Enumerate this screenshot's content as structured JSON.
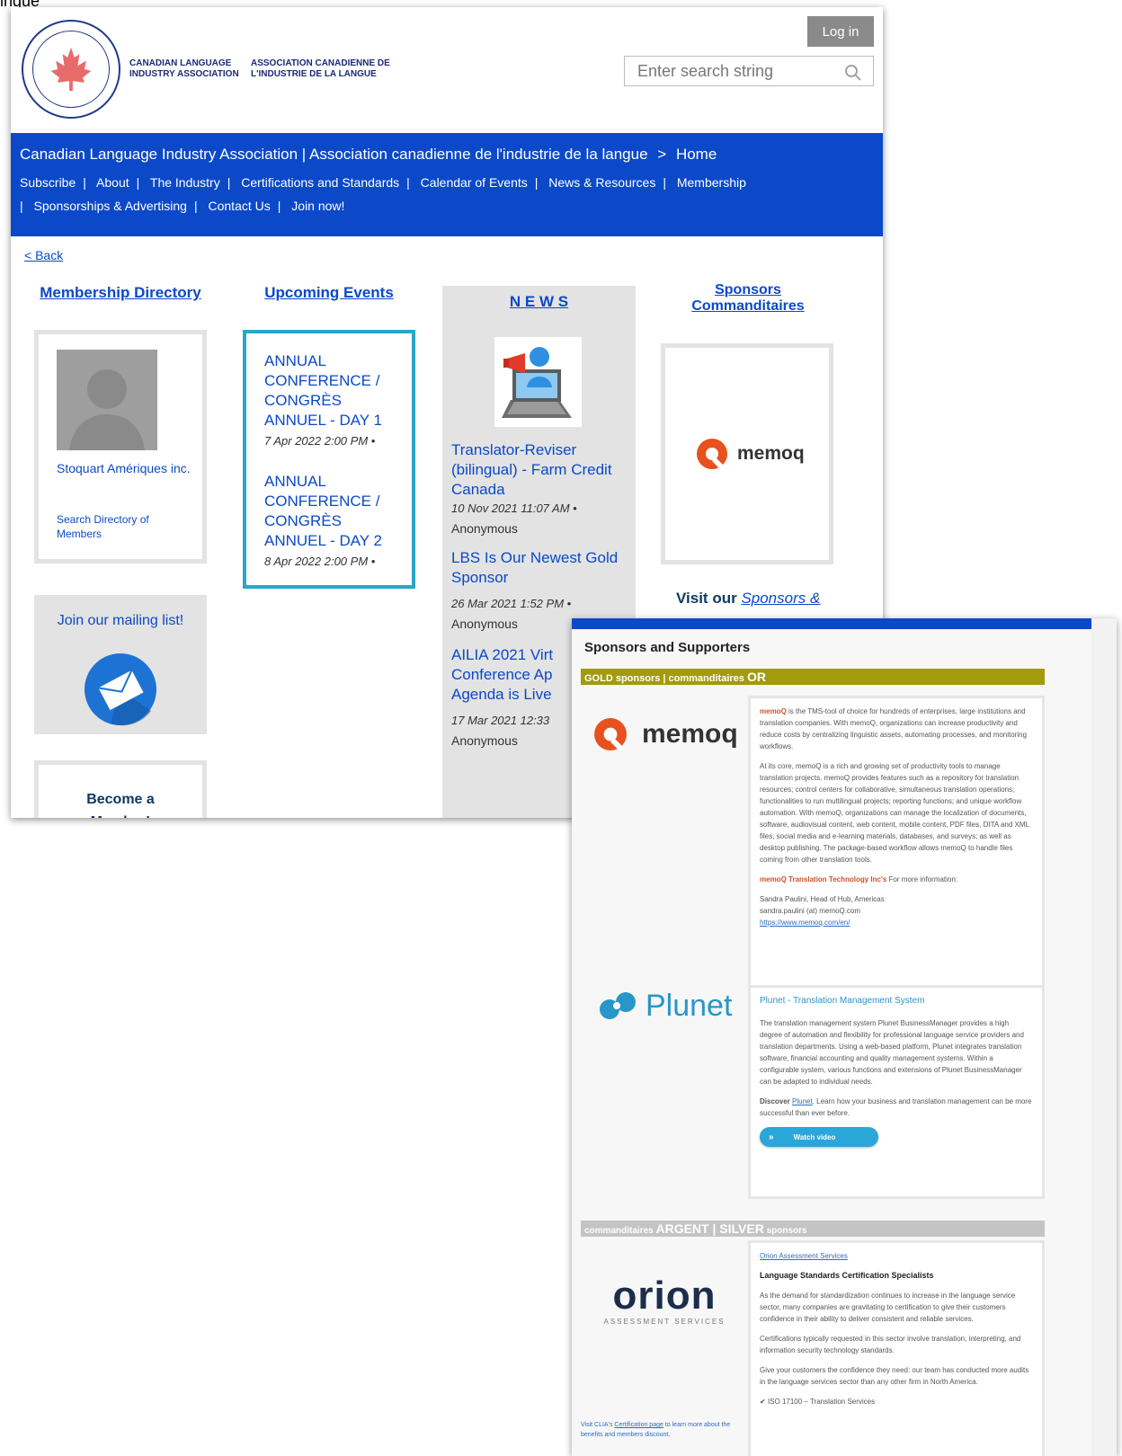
{
  "corner_text": "ingue",
  "header": {
    "org_name_en": "CANADIAN LANGUAGE INDUSTRY ASSOCIATION",
    "org_name_fr": "ASSOCIATION CANADIENNE DE L'INDUSTRIE DE LA LANGUE",
    "login_label": "Log in",
    "search_placeholder": "Enter search string"
  },
  "breadcrumb": {
    "site": "Canadian Language Industry Association | Association canadienne de l'industrie de la langue",
    "separator": ">",
    "current": "Home"
  },
  "nav": {
    "row1": [
      "Subscribe",
      "About",
      "The Industry",
      "Certifications and Standards",
      "Calendar of Events",
      "News & Resources",
      "Membership"
    ],
    "row2": [
      "Sponsorships & Advertising",
      "Contact Us",
      "Join now!"
    ]
  },
  "back_link": "< Back",
  "membership": {
    "title": "Membership Directory",
    "member_name": "Stoquart Amériques inc.",
    "search_link": "Search Directory of Members"
  },
  "mailing": {
    "label": "Join our mailing list!"
  },
  "become": {
    "line1": "Become a",
    "line2": "Member!"
  },
  "events": {
    "title": "Upcoming Events",
    "items": [
      {
        "title": "ANNUAL CONFERENCE / CONGRÈS ANNUEL - DAY 1",
        "date": "7 Apr 2022 2:00 PM •"
      },
      {
        "title": "ANNUAL CONFERENCE / CONGRÈS ANNUEL - DAY 2",
        "date": "8 Apr 2022 2:00 PM •"
      }
    ]
  },
  "news": {
    "title": "N E W S",
    "items": [
      {
        "title": "Translator-Reviser (bilingual) - Farm Credit Canada",
        "date": "10 Nov 2021 11:07 AM •",
        "author": "Anonymous"
      },
      {
        "title": "LBS Is Our Newest Gold Sponsor",
        "date": "26 Mar 2021 1:52 PM •",
        "author": "Anonymous"
      },
      {
        "title": "AILIA 2021 Virt Conference Ap Agenda is Live",
        "date": "17 Mar 2021 12:33",
        "author": "Anonymous"
      }
    ]
  },
  "sponsors": {
    "title_line1": "Sponsors",
    "title_line2": "Commanditaires",
    "logo_word": "memoq",
    "visit_prefix": "Visit our",
    "visit_link": "Sponsors &"
  },
  "overlay": {
    "heading": "Sponsors and Supporters",
    "gold_bar_small": "GOLD sponsors | commanditaires",
    "gold_bar_big": "OR",
    "silver_bar_small": "commanditaires",
    "silver_bar_big": "ARGENT | SILVER",
    "silver_bar_tail": "sponsors",
    "memoq": {
      "logo_word": "memoq",
      "p1_brand": "memoQ",
      "p1": "is the TMS-tool of choice for hundreds of enterprises, large institutions and translation companies. With memoQ, organizations can increase productivity and reduce costs by centralizing linguistic assets, automating processes, and monitoring workflows.",
      "p2": "At its core, memoQ is a rich and growing set of productivity tools to manage translation projects. memoQ provides features such as a repository for translation resources; control centers for collaborative, simultaneous translation operations; functionalities to run multilingual projects; reporting functions; and unique workflow automation. With memoQ, organizations can manage the localization of documents, software, audiovisual content, web content, mobile content, PDF files, DITA and XML files, social media and e-learning materials, databases, and surveys; as well as desktop publishing. The package-based workflow allows memoQ to handle files coming from other translation tools.",
      "p3_brand": "memoQ Translation Technology Inc's",
      "p3": "For more information:",
      "contact_name": "Sandra Paulini, Head of Hub, Americas",
      "contact_email": "sandra.paulini (at) memoQ.com",
      "contact_url": "https://www.memoq.com/en/"
    },
    "plunet": {
      "logo_word": "Plunet",
      "title": "Plunet - Translation Management System",
      "p1": "The translation management system Plunet BusinessManager provides a high degree of automation and flexibility for professional language service providers and translation departments. Using a web-based platform, Plunet integrates translation software, financial accounting and quality management systems. Within a configurable system, various functions and extensions of Plunet BusinessManager can be adapted to individual needs.",
      "p2_bold": "Discover",
      "p2_link": "Plunet",
      "p2": ". Learn how your business and translation management can be more successful than ever before.",
      "button_label": "Watch video"
    },
    "orion": {
      "logo_word": "orion",
      "logo_sub": "ASSESSMENT SERVICES",
      "link": "Orion Assessment Services",
      "heading": "Language Standards Certification Specialists",
      "p1": "As the demand for standardization continues to increase in the language service sector, many companies are gravitating to certification to give their customers confidence in their ability to deliver consistent and reliable services.",
      "p2": "Certifications typically requested in this sector involve translation, interpreting, and information security technology standards.",
      "p3": "Give your customers the confidence they need: our team has conducted more audits in the language services sector than any other firm in North America.",
      "p4": "ISO 17100 – Translation Services",
      "clia_prefix": "Visit CLIA's",
      "clia_link": "Certification page",
      "clia_suffix": "to learn more about the benefits and members discount."
    }
  },
  "colors": {
    "nav_blue": "#0b49c9",
    "event_border": "#29a6c9",
    "memoq_orange": "#e8501e",
    "gold_bar": "#a39a0d",
    "silver_bar": "#c4c4c4"
  }
}
